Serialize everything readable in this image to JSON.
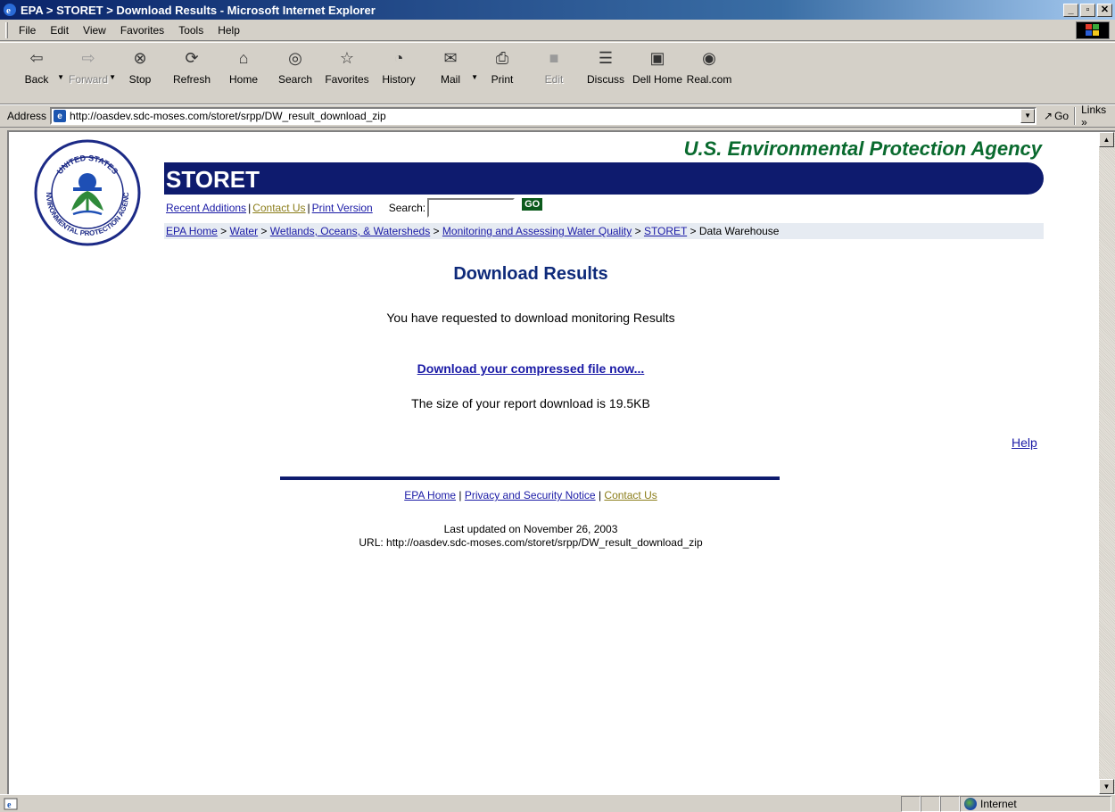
{
  "window": {
    "title": "EPA > STORET > Download Results - Microsoft Internet Explorer",
    "controls": {
      "minimize": "_",
      "maximize": "▫",
      "close": "✕"
    }
  },
  "menu": [
    "File",
    "Edit",
    "View",
    "Favorites",
    "Tools",
    "Help"
  ],
  "toolbar": {
    "buttons": [
      {
        "label": "Back",
        "icon": "back-arrow-icon"
      },
      {
        "label": "Forward",
        "icon": "forward-arrow-icon"
      },
      {
        "label": "Stop",
        "icon": "stop-icon"
      },
      {
        "label": "Refresh",
        "icon": "refresh-icon"
      },
      {
        "label": "Home",
        "icon": "home-icon"
      },
      {
        "label": "Search",
        "icon": "search-icon"
      },
      {
        "label": "Favorites",
        "icon": "favorites-icon"
      },
      {
        "label": "History",
        "icon": "history-icon"
      },
      {
        "label": "Mail",
        "icon": "mail-icon"
      },
      {
        "label": "Print",
        "icon": "print-icon"
      },
      {
        "label": "Edit",
        "icon": "edit-icon"
      },
      {
        "label": "Discuss",
        "icon": "discuss-icon"
      },
      {
        "label": "Dell Home",
        "icon": "dell-home-icon"
      },
      {
        "label": "Real.com",
        "icon": "real-com-icon"
      }
    ]
  },
  "address": {
    "label": "Address",
    "url": "http://oasdev.sdc-moses.com/storet/srpp/DW_result_download_zip",
    "go": "Go",
    "links": "Links »"
  },
  "page": {
    "agency": "U.S. Environmental Protection Agency",
    "brand": "STORET",
    "nav": {
      "recent": "Recent Additions",
      "contact": "Contact Us",
      "print": "Print Version",
      "search_label": "Search:",
      "search_value": "",
      "go": "GO"
    },
    "breadcrumb": {
      "epa_home": "EPA Home",
      "water": "Water",
      "wetlands": "Wetlands, Oceans, & Watersheds",
      "monitoring": "Monitoring and Assessing Water Quality",
      "storet": "STORET",
      "current": "Data Warehouse",
      "sep": ">"
    },
    "heading": "Download Results",
    "intro": "You have requested to download monitoring Results",
    "download_link": "Download your compressed file now...",
    "size_text": "The size of your report download is 19.5KB",
    "help": "Help",
    "footer": {
      "epa_home": "EPA Home",
      "privacy": "Privacy and Security Notice",
      "contact": "Contact Us",
      "updated": "Last updated on November 26, 2003",
      "url": "URL: http://oasdev.sdc-moses.com/storet/srpp/DW_result_download_zip"
    }
  },
  "status": {
    "zone": "Internet"
  },
  "colors": {
    "titlebar": "#0a246a",
    "storet_bar": "#0e1b6e",
    "agency_green": "#096a2e",
    "heading_blue": "#0e2a7a",
    "link_blue": "#1a1aa6",
    "olive_link": "#8b7d1a"
  }
}
